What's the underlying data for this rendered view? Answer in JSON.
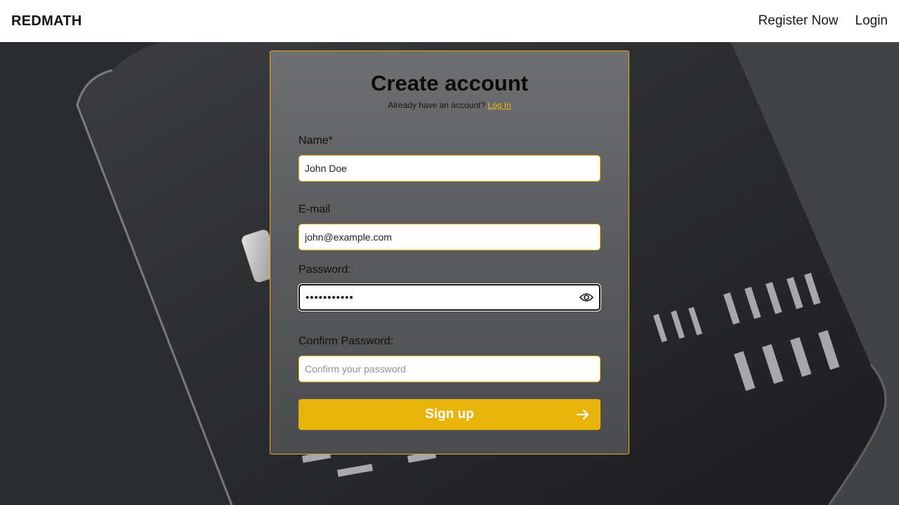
{
  "navbar": {
    "brand": "REDMATH",
    "links": [
      {
        "label": "Register Now"
      },
      {
        "label": "Login"
      }
    ]
  },
  "form": {
    "title": "Create account",
    "subtitle_text": "Already have an account?",
    "subtitle_link": "Log In",
    "name": {
      "label": "Name*",
      "value": "John Doe"
    },
    "email": {
      "label": "E-mail",
      "value": "john@example.com"
    },
    "password": {
      "label": "Password:",
      "masked_value": "•••••••••••"
    },
    "confirm_password": {
      "label": "Confirm Password:",
      "placeholder": "Confirm your password"
    },
    "submit_label": "Sign up"
  },
  "colors": {
    "accent": "#e8b30b",
    "card_border": "#e6b010",
    "navbar_bg": "#ffffff"
  },
  "icons": [
    "eye-icon",
    "arrow-right-icon"
  ]
}
